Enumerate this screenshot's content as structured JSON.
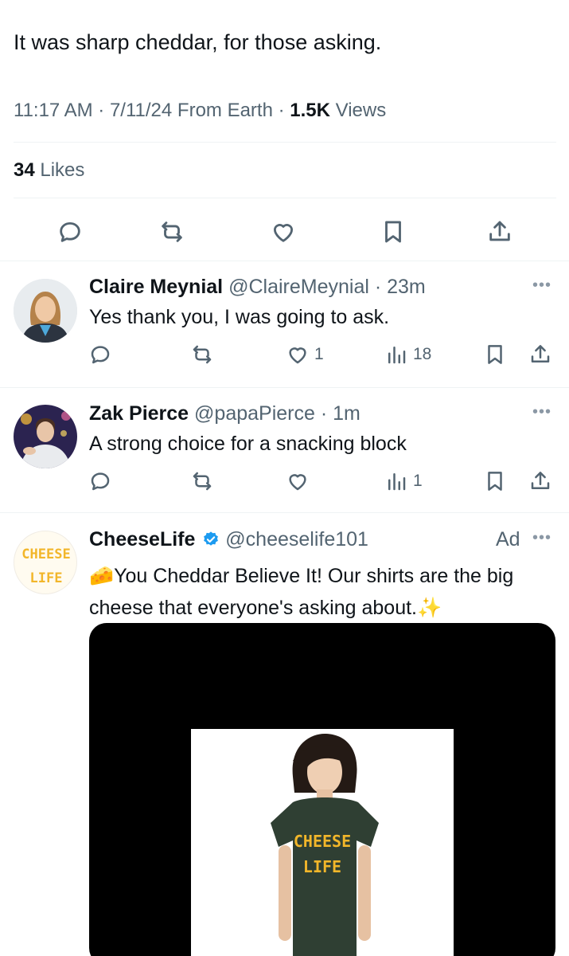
{
  "tweet": {
    "text": "It was sharp cheddar, for those asking.",
    "time": "11:17 AM · 7/11/24 From Earth · ",
    "views_count": "1.5K",
    "views_label": " Views",
    "likes_count": "34",
    "likes_label": " Likes"
  },
  "action_bar": {
    "icons": [
      "reply-icon",
      "retweet-icon",
      "like-icon",
      "bookmark-icon",
      "share-icon"
    ]
  },
  "replies": [
    {
      "name": "Claire Meynial",
      "handle": " @ClaireMeynial",
      "time": " · 23m",
      "text": "Yes thank you, I was going to ask.",
      "likes": "1",
      "views": "18"
    },
    {
      "name": "Zak Pierce",
      "handle": " @papaPierce",
      "time": " · 1m",
      "text": "A strong choice for a snacking block",
      "likes": "",
      "views": "1"
    }
  ],
  "ad": {
    "name": "CheeseLife",
    "handle": " @cheeselife101",
    "label": "Ad",
    "text": "🧀You Cheddar Believe It! Our shirts are the big cheese that everyone's asking about.✨",
    "logo_line1": "CHEESE",
    "logo_line2": "LIFE",
    "shirt_line1": "CHEESE",
    "shirt_line2": "LIFE"
  },
  "colors": {
    "text": "#0f1419",
    "secondary": "#536471",
    "verified": "#1d9bf0",
    "cheese": "#f2b62a"
  }
}
